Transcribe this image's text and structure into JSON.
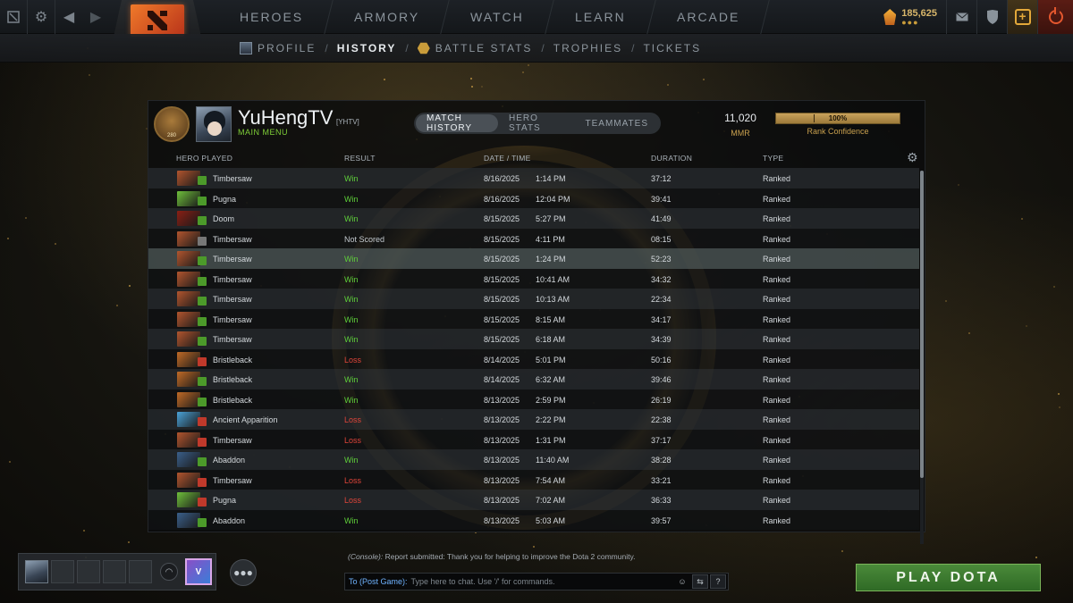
{
  "topbar": {
    "nav": [
      "HEROES",
      "ARMORY",
      "WATCH",
      "LEARN",
      "ARCADE"
    ],
    "shards": "185,625",
    "icons": {
      "dota": "dota-logo-icon",
      "settings": "gear-icon",
      "back": "chevron-left-icon",
      "forward": "chevron-right-icon",
      "mail": "mail-icon",
      "store": "armor-icon",
      "plus": "dota-plus-icon",
      "power": "power-icon"
    }
  },
  "subnav": {
    "items": [
      "PROFILE",
      "HISTORY",
      "BATTLE STATS",
      "TROPHIES",
      "TICKETS"
    ],
    "active": "HISTORY"
  },
  "profile": {
    "rank_number": "280",
    "name": "YuHengTV",
    "tag": "[YHTV]",
    "status": "MAIN MENU",
    "tabs": [
      "MATCH HISTORY",
      "HERO STATS",
      "TEAMMATES"
    ],
    "active_tab": "MATCH HISTORY",
    "mmr_value": "11,020",
    "mmr_label": "MMR",
    "confidence_value": "100%",
    "confidence_fraction": 1.0,
    "confidence_label": "Rank Confidence"
  },
  "table": {
    "headers": {
      "hero": "HERO PLAYED",
      "result": "RESULT",
      "datetime": "DATE / TIME",
      "duration": "DURATION",
      "type": "TYPE"
    },
    "rows": [
      {
        "hero": "Timbersaw",
        "result": "Win",
        "date": "8/16/2025",
        "time": "1:14 PM",
        "duration": "37:12",
        "type": "Ranked"
      },
      {
        "hero": "Pugna",
        "result": "Win",
        "date": "8/16/2025",
        "time": "12:04 PM",
        "duration": "39:41",
        "type": "Ranked"
      },
      {
        "hero": "Doom",
        "result": "Win",
        "date": "8/15/2025",
        "time": "5:27 PM",
        "duration": "41:49",
        "type": "Ranked"
      },
      {
        "hero": "Timbersaw",
        "result": "Not Scored",
        "date": "8/15/2025",
        "time": "4:11 PM",
        "duration": "08:15",
        "type": "Ranked"
      },
      {
        "hero": "Timbersaw",
        "result": "Win",
        "date": "8/15/2025",
        "time": "1:24 PM",
        "duration": "52:23",
        "type": "Ranked"
      },
      {
        "hero": "Timbersaw",
        "result": "Win",
        "date": "8/15/2025",
        "time": "10:41 AM",
        "duration": "34:32",
        "type": "Ranked"
      },
      {
        "hero": "Timbersaw",
        "result": "Win",
        "date": "8/15/2025",
        "time": "10:13 AM",
        "duration": "22:34",
        "type": "Ranked"
      },
      {
        "hero": "Timbersaw",
        "result": "Win",
        "date": "8/15/2025",
        "time": "8:15 AM",
        "duration": "34:17",
        "type": "Ranked"
      },
      {
        "hero": "Timbersaw",
        "result": "Win",
        "date": "8/15/2025",
        "time": "6:18 AM",
        "duration": "34:39",
        "type": "Ranked"
      },
      {
        "hero": "Bristleback",
        "result": "Loss",
        "date": "8/14/2025",
        "time": "5:01 PM",
        "duration": "50:16",
        "type": "Ranked"
      },
      {
        "hero": "Bristleback",
        "result": "Win",
        "date": "8/14/2025",
        "time": "6:32 AM",
        "duration": "39:46",
        "type": "Ranked"
      },
      {
        "hero": "Bristleback",
        "result": "Win",
        "date": "8/13/2025",
        "time": "2:59 PM",
        "duration": "26:19",
        "type": "Ranked"
      },
      {
        "hero": "Ancient Apparition",
        "result": "Loss",
        "date": "8/13/2025",
        "time": "2:22 PM",
        "duration": "22:38",
        "type": "Ranked"
      },
      {
        "hero": "Timbersaw",
        "result": "Loss",
        "date": "8/13/2025",
        "time": "1:31 PM",
        "duration": "37:17",
        "type": "Ranked"
      },
      {
        "hero": "Abaddon",
        "result": "Win",
        "date": "8/13/2025",
        "time": "11:40 AM",
        "duration": "38:28",
        "type": "Ranked"
      },
      {
        "hero": "Timbersaw",
        "result": "Loss",
        "date": "8/13/2025",
        "time": "7:54 AM",
        "duration": "33:21",
        "type": "Ranked"
      },
      {
        "hero": "Pugna",
        "result": "Loss",
        "date": "8/13/2025",
        "time": "7:02 AM",
        "duration": "36:33",
        "type": "Ranked"
      },
      {
        "hero": "Abaddon",
        "result": "Win",
        "date": "8/13/2025",
        "time": "5:03 AM",
        "duration": "39:57",
        "type": "Ranked"
      }
    ],
    "highlighted_row": 4
  },
  "hero_colors": {
    "Timbersaw": "#b2552e",
    "Pugna": "#6fbf3b",
    "Doom": "#8a1f14",
    "Bristleback": "#c06a26",
    "Ancient Apparition": "#4aa2d8",
    "Abaddon": "#3a5f8a"
  },
  "result_colors": {
    "Win": "#5fcf3a",
    "Loss": "#e0453a",
    "Not Scored": "#c3c9ce"
  },
  "chat": {
    "log_prefix": "(Console):",
    "log_text": "Report submitted: Thank you for helping to improve the Dota 2 community.",
    "channel": "To (Post Game):",
    "placeholder": "Type here to chat. Use '/' for commands.",
    "help": "?"
  },
  "play_button": "PLAY DOTA"
}
